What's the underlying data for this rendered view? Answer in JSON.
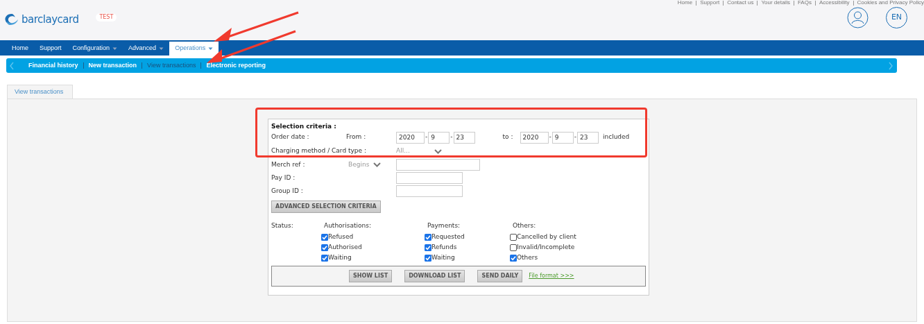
{
  "top_links": [
    "Home",
    "Support",
    "Contact us",
    "Your details",
    "FAQs",
    "Accessibility",
    "Cookies and Privacy Policy"
  ],
  "header": {
    "logo": "barclaycard",
    "badge": "TEST",
    "language": "EN"
  },
  "nav": [
    {
      "label": "Home",
      "dropdown": false,
      "selected": false
    },
    {
      "label": "Support",
      "dropdown": false,
      "selected": false
    },
    {
      "label": "Configuration",
      "dropdown": true,
      "selected": false
    },
    {
      "label": "Advanced",
      "dropdown": true,
      "selected": false
    },
    {
      "label": "Operations",
      "dropdown": true,
      "selected": true
    }
  ],
  "subnav": [
    {
      "label": "Financial history",
      "selected": false
    },
    {
      "label": "New transaction",
      "selected": false
    },
    {
      "label": "View transactions",
      "selected": true
    },
    {
      "label": "Electronic reporting",
      "selected": false
    }
  ],
  "page_tab": {
    "label": "View transactions",
    "selected": true
  },
  "form": {
    "title": "Selection criteria :",
    "order_date": {
      "date_separator": "-",
      "label": "Order date :",
      "from_label": "From :",
      "from": [
        "2020",
        "9",
        "23"
      ],
      "to_label": "to :",
      "to": [
        "2020",
        "9",
        "23"
      ],
      "suffix": "included"
    },
    "card_type": {
      "label": "Charging method / Card type :",
      "value": "All..."
    },
    "fields": [
      {
        "label": "Merch ref :",
        "mode": "Begins"
      },
      {
        "label": "Pay ID :"
      },
      {
        "label": "Group ID :"
      }
    ],
    "advanced_button": "ADVANCED SELECTION CRITERIA",
    "status": {
      "label": "Status:",
      "groups": [
        {
          "title": "Authorisations:",
          "options": [
            {
              "label": "Refused",
              "checked": true
            },
            {
              "label": "Authorised",
              "checked": true
            },
            {
              "label": "Waiting",
              "checked": true
            }
          ]
        },
        {
          "title": "Payments:",
          "options": [
            {
              "label": "Requested",
              "checked": true
            },
            {
              "label": "Refunds",
              "checked": true
            },
            {
              "label": "Waiting",
              "checked": true
            }
          ]
        },
        {
          "title": "Others:",
          "options": [
            {
              "label": "Cancelled by client",
              "checked": false
            },
            {
              "label": "Invalid/Incomplete",
              "checked": false
            },
            {
              "label": "Others",
              "checked": true
            }
          ]
        }
      ]
    },
    "buttons": [
      "SHOW LIST",
      "DOWNLOAD LIST",
      "SEND DAILY"
    ],
    "link": "File format >>>"
  }
}
